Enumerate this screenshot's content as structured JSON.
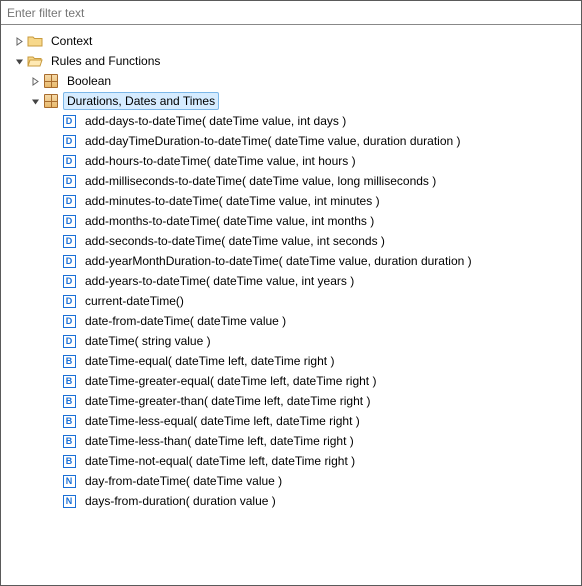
{
  "filter": {
    "placeholder": "Enter filter text"
  },
  "tree": [
    {
      "indent": 0,
      "twisty": "closed",
      "icon": "folder-closed",
      "label": "Context",
      "selected": false,
      "name": "node-context"
    },
    {
      "indent": 0,
      "twisty": "open",
      "icon": "folder-open",
      "label": "Rules and Functions",
      "selected": false,
      "name": "node-rules-functions"
    },
    {
      "indent": 1,
      "twisty": "closed",
      "icon": "package",
      "label": "Boolean",
      "selected": false,
      "name": "node-boolean"
    },
    {
      "indent": 1,
      "twisty": "open",
      "icon": "package",
      "label": "Durations, Dates and Times",
      "selected": true,
      "name": "node-durations-dates-times"
    },
    {
      "indent": 2,
      "twisty": "none",
      "icon": "D",
      "label": "add-days-to-dateTime( dateTime value, int days )",
      "selected": false,
      "name": "fn-add-days-to-datetime"
    },
    {
      "indent": 2,
      "twisty": "none",
      "icon": "D",
      "label": "add-dayTimeDuration-to-dateTime( dateTime value, duration duration )",
      "selected": false,
      "name": "fn-add-daytimeduration-to-datetime"
    },
    {
      "indent": 2,
      "twisty": "none",
      "icon": "D",
      "label": "add-hours-to-dateTime( dateTime value, int hours )",
      "selected": false,
      "name": "fn-add-hours-to-datetime"
    },
    {
      "indent": 2,
      "twisty": "none",
      "icon": "D",
      "label": "add-milliseconds-to-dateTime( dateTime value, long milliseconds )",
      "selected": false,
      "name": "fn-add-milliseconds-to-datetime"
    },
    {
      "indent": 2,
      "twisty": "none",
      "icon": "D",
      "label": "add-minutes-to-dateTime( dateTime value, int minutes )",
      "selected": false,
      "name": "fn-add-minutes-to-datetime"
    },
    {
      "indent": 2,
      "twisty": "none",
      "icon": "D",
      "label": "add-months-to-dateTime( dateTime value, int months )",
      "selected": false,
      "name": "fn-add-months-to-datetime"
    },
    {
      "indent": 2,
      "twisty": "none",
      "icon": "D",
      "label": "add-seconds-to-dateTime( dateTime value, int seconds )",
      "selected": false,
      "name": "fn-add-seconds-to-datetime"
    },
    {
      "indent": 2,
      "twisty": "none",
      "icon": "D",
      "label": "add-yearMonthDuration-to-dateTime( dateTime value, duration duration )",
      "selected": false,
      "name": "fn-add-yearmonthduration-to-datetime"
    },
    {
      "indent": 2,
      "twisty": "none",
      "icon": "D",
      "label": "add-years-to-dateTime( dateTime value, int years )",
      "selected": false,
      "name": "fn-add-years-to-datetime"
    },
    {
      "indent": 2,
      "twisty": "none",
      "icon": "D",
      "label": "current-dateTime()",
      "selected": false,
      "name": "fn-current-datetime"
    },
    {
      "indent": 2,
      "twisty": "none",
      "icon": "D",
      "label": "date-from-dateTime( dateTime value )",
      "selected": false,
      "name": "fn-date-from-datetime"
    },
    {
      "indent": 2,
      "twisty": "none",
      "icon": "D",
      "label": "dateTime( string value )",
      "selected": false,
      "name": "fn-datetime"
    },
    {
      "indent": 2,
      "twisty": "none",
      "icon": "B",
      "label": "dateTime-equal( dateTime left, dateTime right )",
      "selected": false,
      "name": "fn-datetime-equal"
    },
    {
      "indent": 2,
      "twisty": "none",
      "icon": "B",
      "label": "dateTime-greater-equal( dateTime left, dateTime right )",
      "selected": false,
      "name": "fn-datetime-greater-equal"
    },
    {
      "indent": 2,
      "twisty": "none",
      "icon": "B",
      "label": "dateTime-greater-than( dateTime left, dateTime right )",
      "selected": false,
      "name": "fn-datetime-greater-than"
    },
    {
      "indent": 2,
      "twisty": "none",
      "icon": "B",
      "label": "dateTime-less-equal( dateTime left, dateTime right )",
      "selected": false,
      "name": "fn-datetime-less-equal"
    },
    {
      "indent": 2,
      "twisty": "none",
      "icon": "B",
      "label": "dateTime-less-than( dateTime left, dateTime right )",
      "selected": false,
      "name": "fn-datetime-less-than"
    },
    {
      "indent": 2,
      "twisty": "none",
      "icon": "B",
      "label": "dateTime-not-equal( dateTime left, dateTime right )",
      "selected": false,
      "name": "fn-datetime-not-equal"
    },
    {
      "indent": 2,
      "twisty": "none",
      "icon": "N",
      "label": "day-from-dateTime( dateTime value )",
      "selected": false,
      "name": "fn-day-from-datetime"
    },
    {
      "indent": 2,
      "twisty": "none",
      "icon": "N",
      "label": "days-from-duration( duration value )",
      "selected": false,
      "name": "fn-days-from-duration"
    }
  ]
}
